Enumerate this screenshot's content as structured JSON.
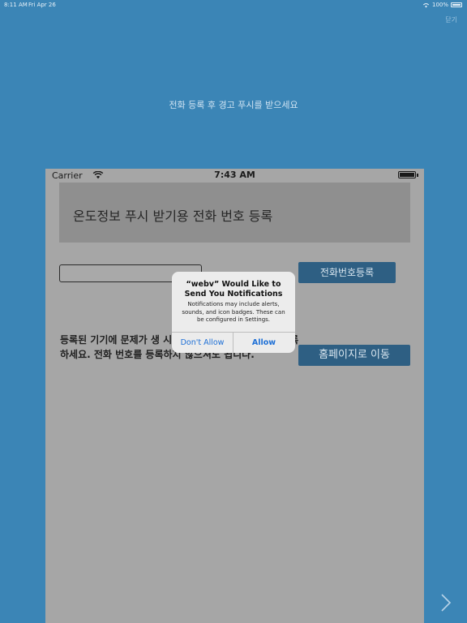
{
  "outer_status": {
    "time": "8:11 AM",
    "date": "Fri Apr 26",
    "battery": "100%"
  },
  "header": {
    "close_label": "닫기",
    "banner": "전화 등록 후 경고 푸시를 받으세요"
  },
  "phone": {
    "status": {
      "carrier": "Carrier",
      "clock": "7:43 AM"
    },
    "title": "온도정보 푸시 받기용 전화 번호 등록",
    "phone_input": {
      "value": "",
      "placeholder": ""
    },
    "register_button": "전화번호등록",
    "body_text": "등록된 기기에 문제가 생 시지를 받으려면 전화번호를 등록하세요. 전화 번호를 등록하지 않으셔도 됩니다.",
    "home_button": "홈페이지로 이동"
  },
  "alert": {
    "title": "“webv” Would Like to Send You Notifications",
    "message": "Notifications may include alerts, sounds, and icon badges. These can be configured in Settings.",
    "dont_allow": "Don't Allow",
    "allow": "Allow",
    "accent": "#1d6fd6"
  },
  "colors": {
    "background": "#3b85b6",
    "button": "#2e5f83"
  },
  "icons": {
    "next": "chevron-right-icon",
    "wifi": "wifi-icon",
    "battery": "battery-icon"
  }
}
